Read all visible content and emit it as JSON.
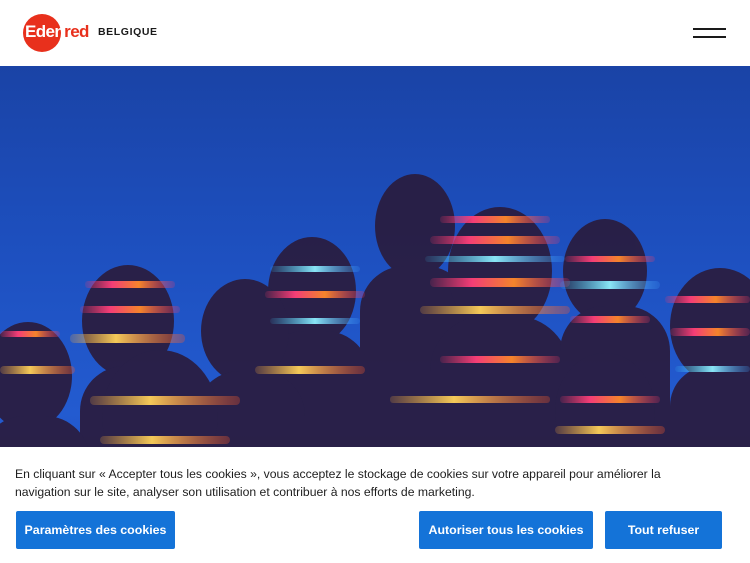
{
  "header": {
    "logo_text": "Eden",
    "logo_text_tail": "red",
    "country": "BELGIQUE",
    "menu_icon": "hamburger-menu-icon"
  },
  "hero": {
    "image": "group-of-people-with-colorful-light-stripes"
  },
  "cookie_banner": {
    "text_line1": "En cliquant sur « Accepter tous les cookies », vous acceptez le stockage de cookies sur votre appareil pour améliorer la",
    "text_line2": "navigation sur le site, analyser son utilisation et contribuer à nos efforts de marketing.",
    "settings_label": "Paramètres des cookies",
    "accept_label": "Autoriser tous les cookies",
    "refuse_label": "Tout refuser"
  },
  "colors": {
    "brand_red": "#e8301c",
    "button_blue": "#1473d8",
    "hero_blue": "#1d4fbe"
  }
}
